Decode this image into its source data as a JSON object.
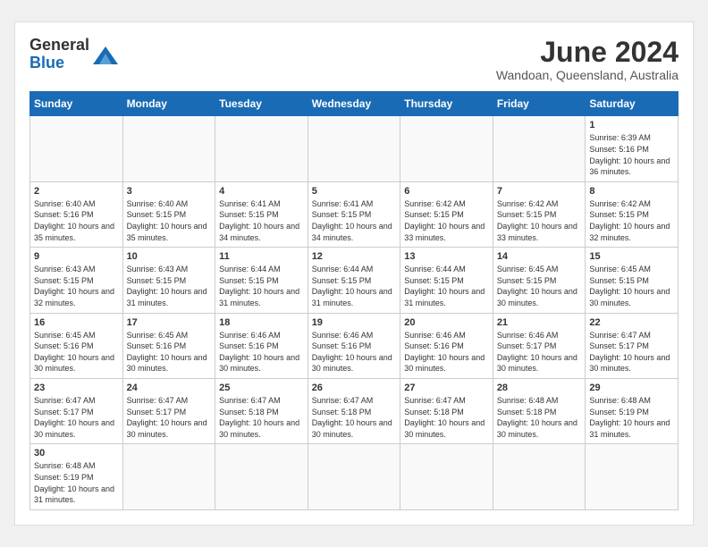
{
  "header": {
    "logo_general": "General",
    "logo_blue": "Blue",
    "month_title": "June 2024",
    "location": "Wandoan, Queensland, Australia"
  },
  "days_of_week": [
    "Sunday",
    "Monday",
    "Tuesday",
    "Wednesday",
    "Thursday",
    "Friday",
    "Saturday"
  ],
  "weeks": [
    [
      null,
      null,
      null,
      null,
      null,
      null,
      {
        "day": 1,
        "sunrise": "6:39 AM",
        "sunset": "5:16 PM",
        "daylight": "10 hours and 36 minutes."
      }
    ],
    [
      {
        "day": 2,
        "sunrise": "6:40 AM",
        "sunset": "5:16 PM",
        "daylight": "10 hours and 35 minutes."
      },
      {
        "day": 3,
        "sunrise": "6:40 AM",
        "sunset": "5:15 PM",
        "daylight": "10 hours and 35 minutes."
      },
      {
        "day": 4,
        "sunrise": "6:41 AM",
        "sunset": "5:15 PM",
        "daylight": "10 hours and 34 minutes."
      },
      {
        "day": 5,
        "sunrise": "6:41 AM",
        "sunset": "5:15 PM",
        "daylight": "10 hours and 34 minutes."
      },
      {
        "day": 6,
        "sunrise": "6:42 AM",
        "sunset": "5:15 PM",
        "daylight": "10 hours and 33 minutes."
      },
      {
        "day": 7,
        "sunrise": "6:42 AM",
        "sunset": "5:15 PM",
        "daylight": "10 hours and 33 minutes."
      },
      {
        "day": 8,
        "sunrise": "6:42 AM",
        "sunset": "5:15 PM",
        "daylight": "10 hours and 32 minutes."
      }
    ],
    [
      {
        "day": 9,
        "sunrise": "6:43 AM",
        "sunset": "5:15 PM",
        "daylight": "10 hours and 32 minutes."
      },
      {
        "day": 10,
        "sunrise": "6:43 AM",
        "sunset": "5:15 PM",
        "daylight": "10 hours and 31 minutes."
      },
      {
        "day": 11,
        "sunrise": "6:44 AM",
        "sunset": "5:15 PM",
        "daylight": "10 hours and 31 minutes."
      },
      {
        "day": 12,
        "sunrise": "6:44 AM",
        "sunset": "5:15 PM",
        "daylight": "10 hours and 31 minutes."
      },
      {
        "day": 13,
        "sunrise": "6:44 AM",
        "sunset": "5:15 PM",
        "daylight": "10 hours and 31 minutes."
      },
      {
        "day": 14,
        "sunrise": "6:45 AM",
        "sunset": "5:15 PM",
        "daylight": "10 hours and 30 minutes."
      },
      {
        "day": 15,
        "sunrise": "6:45 AM",
        "sunset": "5:15 PM",
        "daylight": "10 hours and 30 minutes."
      }
    ],
    [
      {
        "day": 16,
        "sunrise": "6:45 AM",
        "sunset": "5:16 PM",
        "daylight": "10 hours and 30 minutes."
      },
      {
        "day": 17,
        "sunrise": "6:45 AM",
        "sunset": "5:16 PM",
        "daylight": "10 hours and 30 minutes."
      },
      {
        "day": 18,
        "sunrise": "6:46 AM",
        "sunset": "5:16 PM",
        "daylight": "10 hours and 30 minutes."
      },
      {
        "day": 19,
        "sunrise": "6:46 AM",
        "sunset": "5:16 PM",
        "daylight": "10 hours and 30 minutes."
      },
      {
        "day": 20,
        "sunrise": "6:46 AM",
        "sunset": "5:16 PM",
        "daylight": "10 hours and 30 minutes."
      },
      {
        "day": 21,
        "sunrise": "6:46 AM",
        "sunset": "5:17 PM",
        "daylight": "10 hours and 30 minutes."
      },
      {
        "day": 22,
        "sunrise": "6:47 AM",
        "sunset": "5:17 PM",
        "daylight": "10 hours and 30 minutes."
      }
    ],
    [
      {
        "day": 23,
        "sunrise": "6:47 AM",
        "sunset": "5:17 PM",
        "daylight": "10 hours and 30 minutes."
      },
      {
        "day": 24,
        "sunrise": "6:47 AM",
        "sunset": "5:17 PM",
        "daylight": "10 hours and 30 minutes."
      },
      {
        "day": 25,
        "sunrise": "6:47 AM",
        "sunset": "5:18 PM",
        "daylight": "10 hours and 30 minutes."
      },
      {
        "day": 26,
        "sunrise": "6:47 AM",
        "sunset": "5:18 PM",
        "daylight": "10 hours and 30 minutes."
      },
      {
        "day": 27,
        "sunrise": "6:47 AM",
        "sunset": "5:18 PM",
        "daylight": "10 hours and 30 minutes."
      },
      {
        "day": 28,
        "sunrise": "6:48 AM",
        "sunset": "5:18 PM",
        "daylight": "10 hours and 30 minutes."
      },
      {
        "day": 29,
        "sunrise": "6:48 AM",
        "sunset": "5:19 PM",
        "daylight": "10 hours and 31 minutes."
      }
    ],
    [
      {
        "day": 30,
        "sunrise": "6:48 AM",
        "sunset": "5:19 PM",
        "daylight": "10 hours and 31 minutes."
      },
      null,
      null,
      null,
      null,
      null,
      null
    ]
  ]
}
